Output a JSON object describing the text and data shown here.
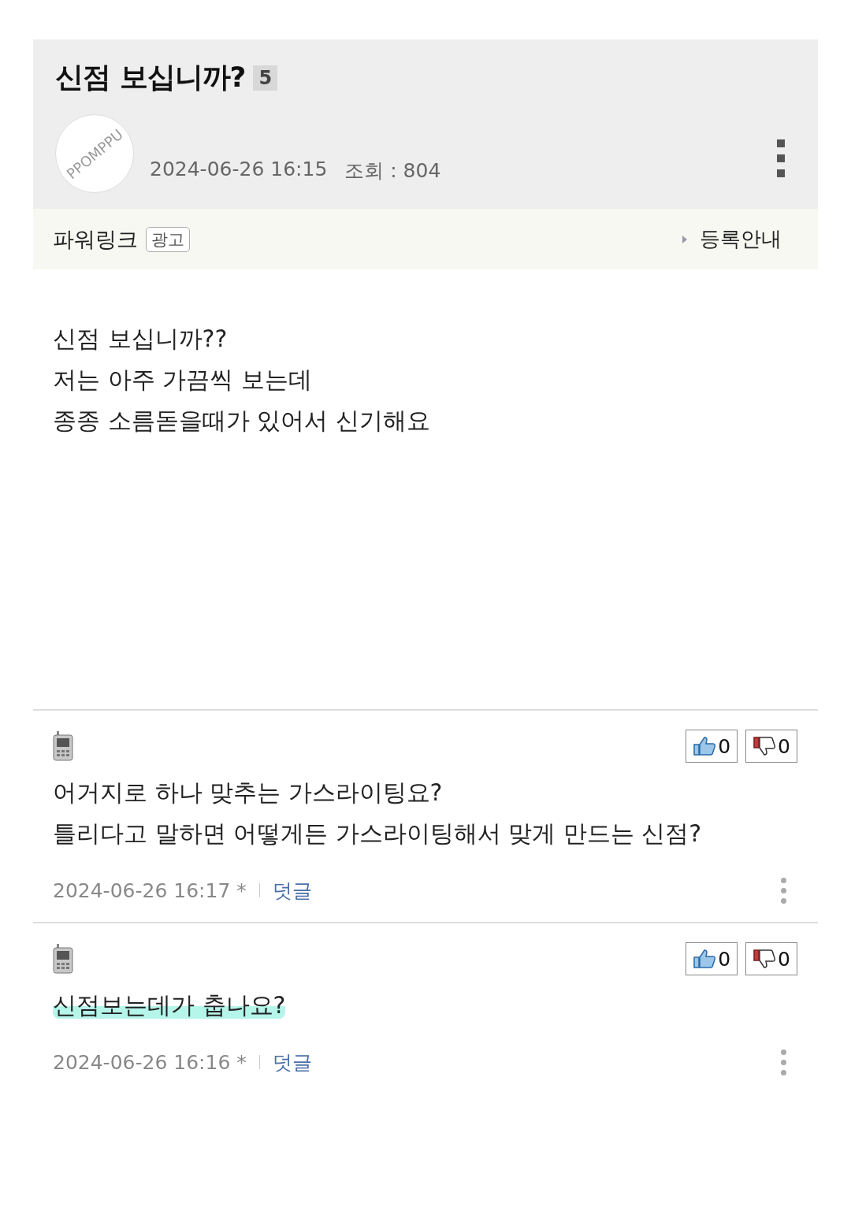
{
  "post": {
    "title": "신점 보십니까?",
    "comment_count": "5",
    "avatar_text": "PPOMPPU",
    "date": "2024-06-26 16:15",
    "views_label": "조회 : 804"
  },
  "powerlink": {
    "label": "파워링크",
    "badge": "광고",
    "link": "등록안내"
  },
  "body": [
    "신점 보십니까??",
    "저는 아주 가끔씩 보는데",
    "종종 소름돋을때가 있어서 신기해요"
  ],
  "comments": [
    {
      "likes": "0",
      "dislikes": "0",
      "lines": [
        "어거지로 하나 맞추는 가스라이팅요?",
        "틀리다고 말하면 어떻게든 가스라이팅해서 맞게 만드는 신점?"
      ],
      "highlighted": false,
      "date": "2024-06-26 16:17 *",
      "reply": "덧글"
    },
    {
      "likes": "0",
      "dislikes": "0",
      "lines": [
        "신점보는데가 춥나요?"
      ],
      "highlighted": true,
      "date": "2024-06-26 16:16 *",
      "reply": "덧글"
    }
  ]
}
